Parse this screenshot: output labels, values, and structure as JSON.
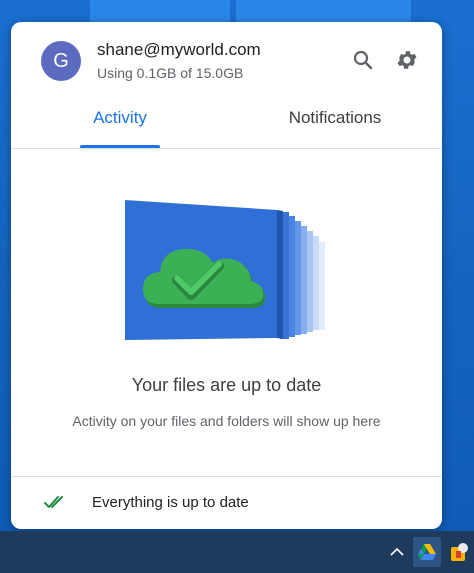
{
  "account": {
    "avatar_letter": "G",
    "email": "shane@myworld.com",
    "usage": "Using 0.1GB of 15.0GB",
    "avatar_color": "#5c6bc0"
  },
  "header": {
    "search_icon": "search-icon",
    "settings_icon": "gear-icon"
  },
  "tabs": [
    {
      "label": "Activity",
      "active": true
    },
    {
      "label": "Notifications",
      "active": false
    }
  ],
  "main": {
    "illustration": "cloud-check-folder",
    "title": "Your files are up to date",
    "subtitle": "Activity on your files and folders will show up here"
  },
  "footer": {
    "status_icon": "double-check-icon",
    "status_text": "Everything is up to date"
  },
  "taskbar": {
    "tray_icons": [
      "chevron-up-icon",
      "google-drive-icon",
      "app-icon"
    ]
  },
  "colors": {
    "accent": "#1a73e8",
    "success": "#34a853",
    "panel_bg": "#ffffff",
    "desktop_bg": "#1565c0",
    "taskbar_bg": "#1e3a5c"
  }
}
